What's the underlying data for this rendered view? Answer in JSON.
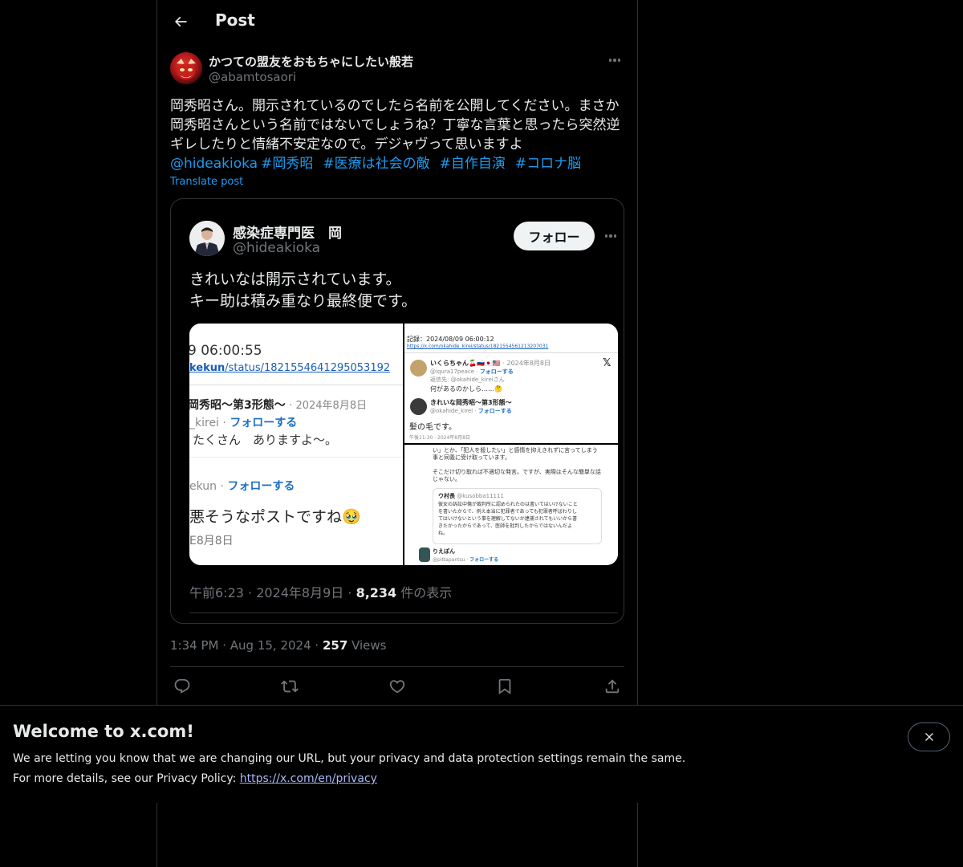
{
  "header": {
    "title": "Post"
  },
  "post": {
    "display_name": "かつての盟友をおもちゃにしたい般若",
    "handle": "@abamtosaori",
    "text_lines": [
      "岡秀昭さん。開示されているのでしたら名前を公開してください。まさか",
      "岡秀昭さんという名前ではないでしょうね？丁寧な言葉と思ったら突然逆",
      "ギレしたりと情緒不安定なので。デジャヴって思いますよ"
    ],
    "mention": "@hideakioka",
    "hashtags": [
      "#岡秀昭",
      "#医療は社会の敵",
      "#自作自演",
      "#コロナ脳"
    ],
    "translate_label": "Translate post",
    "time": "1:34 PM",
    "date": "Aug 15, 2024",
    "views_count": "257",
    "views_label": "Views"
  },
  "quote": {
    "display_name": "感染症専門医　岡",
    "handle": "@hideakioka",
    "follow_label": "フォロー",
    "text_lines": [
      "きれいなは開示されています。",
      "キー助は積み重なり最終便です。"
    ],
    "time": "午前6:23",
    "date": "2024年8月9日",
    "views_count": "8,234",
    "views_label": "件の表示",
    "media": {
      "left": {
        "time": "9 06:00:55",
        "link_bold": "kekun",
        "link_rest": "/status/1821554641295053192",
        "name": "岡秀昭〜第3形態〜",
        "date": "· 2024年8月8日",
        "handle": "_kirei ·",
        "follow": "フォローする",
        "reply": "たくさん　ありますよ〜。",
        "handle2": "ekun ·",
        "follow2": "フォローする",
        "comment": "悪そうなポストですね🥹",
        "date2": "E8月8日"
      },
      "right_top": {
        "record": "記録：2024/08/09 06:00:12",
        "url": "https://x.com/okahide_kirei/status/1821554561213207031",
        "user1": "いくらちゃん🍒🇷🇺🇯🇵🇺🇸",
        "user1_date": "· 2024年8月8日",
        "user1_handle": "@iqura17peace ·",
        "follow": "フォローする",
        "reply_to": "返信先: @okahide_kireiさん",
        "user1_text": "何があるのかしら……🤔",
        "user2": "きれいな岡秀昭〜第3形態〜",
        "user2_handle": "@okahide_kirei ·",
        "user2_text": "髪の毛です。",
        "footer": "午後11:30 · 2024年8月8日",
        "x_mark": "𝕏"
      },
      "right_bot": {
        "line1": "い」とか、「犯人を殺したい」と感情を抑えきれずに言ってしまう",
        "line2": "事と同義に受け取っています。",
        "line3": "そこだけ切り取れば不適切な発言。ですが、実際はそんな簡単な話",
        "line4": "じゃない。",
        "q_user": "ウ村長",
        "q_handle": "@kusobba11111",
        "q_line1": "彼女の訴訟中傷が裁判所に認められたのは書いてはいけないこと",
        "q_line2": "を書いたからで、例え本当に犯罪者であっても犯罪者呼ばわりし",
        "q_line3": "てはいけないという事を理解してないか逮捕されてもいいから書",
        "q_line4": "きたかったからであって、医師を批判したからではないんだよ",
        "q_line5": "ね。",
        "user": "りえぽん",
        "user_handle": "@pittapantsu ·",
        "follow": "フォローする"
      }
    }
  },
  "banner": {
    "title": "Welcome to x.com!",
    "line1": "We are letting you know that we are changing our URL, but your privacy and data protection settings remain the same.",
    "line2_prefix": "For more details, see our Privacy Policy:",
    "link": "https://x.com/en/privacy"
  },
  "icons": {
    "back": "arrow-left-icon",
    "more": "more-horizontal-icon",
    "reply": "reply-icon",
    "repost": "repost-icon",
    "like": "heart-icon",
    "bookmark": "bookmark-icon",
    "share": "share-icon",
    "close": "close-icon"
  },
  "colors": {
    "accent": "#1d9bf0",
    "background": "#000000",
    "text": "#e7e9ea",
    "muted": "#71767b",
    "border": "#2f3336"
  }
}
